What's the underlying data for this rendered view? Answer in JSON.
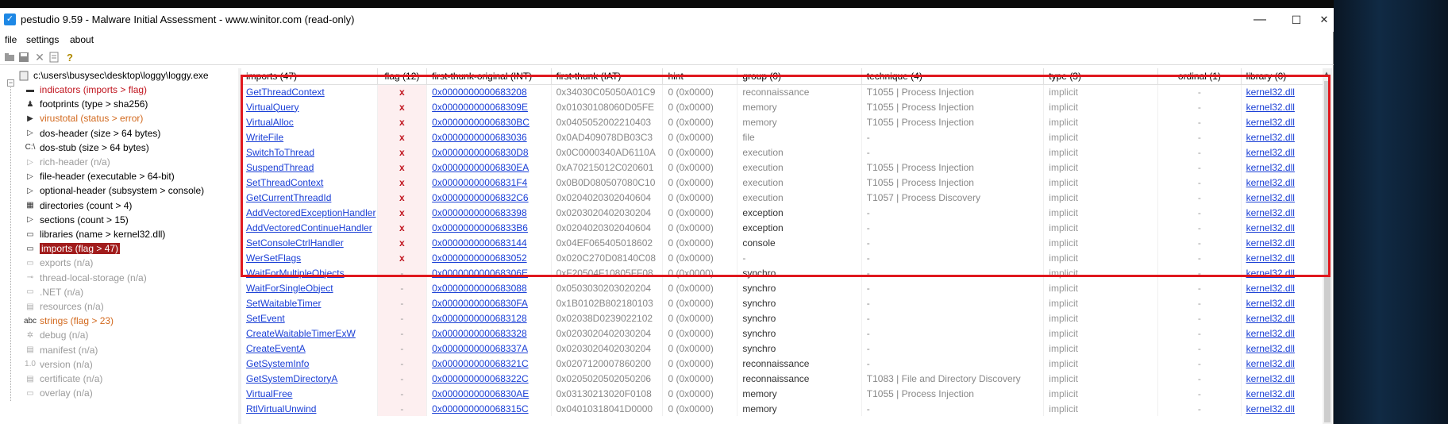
{
  "window": {
    "title": "pestudio 9.59 - Malware Initial Assessment - www.winitor.com (read-only)",
    "minimize": "—",
    "maximize": "☐",
    "close": "✕"
  },
  "menu": [
    "file",
    "settings",
    "about"
  ],
  "toolbar": [
    "open-icon",
    "save-icon",
    "close-file-icon",
    "copy-icon",
    "help-icon"
  ],
  "tree": {
    "root": "c:\\users\\busysec\\desktop\\loggy\\loggy.exe",
    "items": [
      {
        "label": "indicators (imports > flag)",
        "style": "red",
        "icon": "indicator-icon",
        "glyph": "▬"
      },
      {
        "label": "footprints (type > sha256)",
        "style": "normal",
        "icon": "footprint-icon",
        "glyph": "♟"
      },
      {
        "label": "virustotal (status > error)",
        "style": "orange",
        "icon": "virustotal-icon",
        "glyph": "▶"
      },
      {
        "label": "dos-header (size > 64 bytes)",
        "style": "normal",
        "icon": "expand-icon",
        "glyph": "▷"
      },
      {
        "label": "dos-stub (size > 64 bytes)",
        "style": "normal",
        "icon": "console-icon",
        "glyph": "C:\\"
      },
      {
        "label": "rich-header (n/a)",
        "style": "gray",
        "icon": "expand-icon",
        "glyph": "▷"
      },
      {
        "label": "file-header (executable > 64-bit)",
        "style": "normal",
        "icon": "expand-icon",
        "glyph": "▷"
      },
      {
        "label": "optional-header (subsystem > console)",
        "style": "normal",
        "icon": "expand-icon",
        "glyph": "▷"
      },
      {
        "label": "directories (count > 4)",
        "style": "normal",
        "icon": "directory-icon",
        "glyph": "▦"
      },
      {
        "label": "sections (count > 15)",
        "style": "normal",
        "icon": "expand-icon",
        "glyph": "▷"
      },
      {
        "label": "libraries (name > kernel32.dll)",
        "style": "normal",
        "icon": "library-icon",
        "glyph": "▭"
      },
      {
        "label": "imports (flag > 47)",
        "style": "selected",
        "icon": "imports-icon",
        "glyph": "▭"
      },
      {
        "label": "exports (n/a)",
        "style": "gray",
        "icon": "exports-icon",
        "glyph": "▭"
      },
      {
        "label": "thread-local-storage (n/a)",
        "style": "gray",
        "icon": "tls-icon",
        "glyph": "⊸"
      },
      {
        "label": ".NET (n/a)",
        "style": "gray",
        "icon": "dotnet-icon",
        "glyph": "▭"
      },
      {
        "label": "resources (n/a)",
        "style": "gray",
        "icon": "resources-icon",
        "glyph": "▤"
      },
      {
        "label": "strings (flag > 23)",
        "style": "orange",
        "icon": "strings-icon",
        "glyph": "abc"
      },
      {
        "label": "debug (n/a)",
        "style": "gray",
        "icon": "debug-icon",
        "glyph": "✲"
      },
      {
        "label": "manifest (n/a)",
        "style": "gray",
        "icon": "manifest-icon",
        "glyph": "▤"
      },
      {
        "label": "version (n/a)",
        "style": "gray",
        "icon": "version-icon",
        "glyph": "1.0"
      },
      {
        "label": "certificate (n/a)",
        "style": "gray",
        "icon": "certificate-icon",
        "glyph": "▤"
      },
      {
        "label": "overlay (n/a)",
        "style": "gray",
        "icon": "overlay-icon",
        "glyph": "▭"
      }
    ]
  },
  "table": {
    "columns": [
      "imports (47)",
      "flag (12)",
      "first-thunk-original (INT)",
      "first-thunk (IAT)",
      "hint",
      "group (0)",
      "technique (4)",
      "type (3)",
      "ordinal (1)",
      "library (0)"
    ],
    "rows": [
      [
        "GetThreadContext",
        "x",
        "0x0000000000683208",
        "0x34030C05050A01C9",
        "0 (0x0000)",
        "reconnaissance",
        "T1055 | Process Injection",
        "implicit",
        "-",
        "kernel32.dll"
      ],
      [
        "VirtualQuery",
        "x",
        "0x000000000068309E",
        "0x01030108060D05FE",
        "0 (0x0000)",
        "memory",
        "T1055 | Process Injection",
        "implicit",
        "-",
        "kernel32.dll"
      ],
      [
        "VirtualAlloc",
        "x",
        "0x00000000006830BC",
        "0x0405052002210403",
        "0 (0x0000)",
        "memory",
        "T1055 | Process Injection",
        "implicit",
        "-",
        "kernel32.dll"
      ],
      [
        "WriteFile",
        "x",
        "0x0000000000683036",
        "0x0AD409078DB03C3",
        "0 (0x0000)",
        "file",
        "-",
        "implicit",
        "-",
        "kernel32.dll"
      ],
      [
        "SwitchToThread",
        "x",
        "0x00000000006830D8",
        "0x0C0000340AD6110A",
        "0 (0x0000)",
        "execution",
        "-",
        "implicit",
        "-",
        "kernel32.dll"
      ],
      [
        "SuspendThread",
        "x",
        "0x00000000006830EA",
        "0xA70215012C020601",
        "0 (0x0000)",
        "execution",
        "T1055 | Process Injection",
        "implicit",
        "-",
        "kernel32.dll"
      ],
      [
        "SetThreadContext",
        "x",
        "0x00000000006831F4",
        "0x0B0D080507080C10",
        "0 (0x0000)",
        "execution",
        "T1055 | Process Injection",
        "implicit",
        "-",
        "kernel32.dll"
      ],
      [
        "GetCurrentThreadId",
        "x",
        "0x00000000006832C6",
        "0x0204020302040604",
        "0 (0x0000)",
        "execution",
        "T1057 | Process Discovery",
        "implicit",
        "-",
        "kernel32.dll"
      ],
      [
        "AddVectoredExceptionHandler",
        "x",
        "0x0000000000683398",
        "0x0203020402030204",
        "0 (0x0000)",
        "exception",
        "-",
        "implicit",
        "-",
        "kernel32.dll"
      ],
      [
        "AddVectoredContinueHandler",
        "x",
        "0x00000000006833B6",
        "0x0204020302040604",
        "0 (0x0000)",
        "exception",
        "-",
        "implicit",
        "-",
        "kernel32.dll"
      ],
      [
        "SetConsoleCtrlHandler",
        "x",
        "0x0000000000683144",
        "0x04EF065405018602",
        "0 (0x0000)",
        "console",
        "-",
        "implicit",
        "-",
        "kernel32.dll"
      ],
      [
        "WerSetFlags",
        "x",
        "0x0000000000683052",
        "0x020C270D08140C08",
        "0 (0x0000)",
        "-",
        "-",
        "implicit",
        "-",
        "kernel32.dll"
      ],
      [
        "WaitForMultipleObjects",
        "-",
        "0x000000000068306E",
        "0xF20504F10805FF08",
        "0 (0x0000)",
        "synchro",
        "-",
        "implicit",
        "-",
        "kernel32.dll"
      ],
      [
        "WaitForSingleObject",
        "-",
        "0x0000000000683088",
        "0x0503030203020204",
        "0 (0x0000)",
        "synchro",
        "-",
        "implicit",
        "-",
        "kernel32.dll"
      ],
      [
        "SetWaitableTimer",
        "-",
        "0x00000000006830FA",
        "0x1B0102B802180103",
        "0 (0x0000)",
        "synchro",
        "-",
        "implicit",
        "-",
        "kernel32.dll"
      ],
      [
        "SetEvent",
        "-",
        "0x0000000000683128",
        "0x02038D0239022102",
        "0 (0x0000)",
        "synchro",
        "-",
        "implicit",
        "-",
        "kernel32.dll"
      ],
      [
        "CreateWaitableTimerExW",
        "-",
        "0x0000000000683328",
        "0x0203020402030204",
        "0 (0x0000)",
        "synchro",
        "-",
        "implicit",
        "-",
        "kernel32.dll"
      ],
      [
        "CreateEventA",
        "-",
        "0x000000000068337A",
        "0x0203020402030204",
        "0 (0x0000)",
        "synchro",
        "-",
        "implicit",
        "-",
        "kernel32.dll"
      ],
      [
        "GetSystemInfo",
        "-",
        "0x000000000068321C",
        "0x0207120007860200",
        "0 (0x0000)",
        "reconnaissance",
        "-",
        "implicit",
        "-",
        "kernel32.dll"
      ],
      [
        "GetSystemDirectoryA",
        "-",
        "0x000000000068322C",
        "0x0205020502050206",
        "0 (0x0000)",
        "reconnaissance",
        "T1083 | File and Directory Discovery",
        "implicit",
        "-",
        "kernel32.dll"
      ],
      [
        "VirtualFree",
        "-",
        "0x00000000006830AE",
        "0x03130213020F0108",
        "0 (0x0000)",
        "memory",
        "T1055 | Process Injection",
        "implicit",
        "-",
        "kernel32.dll"
      ],
      [
        "RtlVirtualUnwind",
        "-",
        "0x000000000068315C",
        "0x04010318041D0000",
        "0 (0x0000)",
        "memory",
        "-",
        "implicit",
        "-",
        "kernel32.dll"
      ]
    ]
  }
}
